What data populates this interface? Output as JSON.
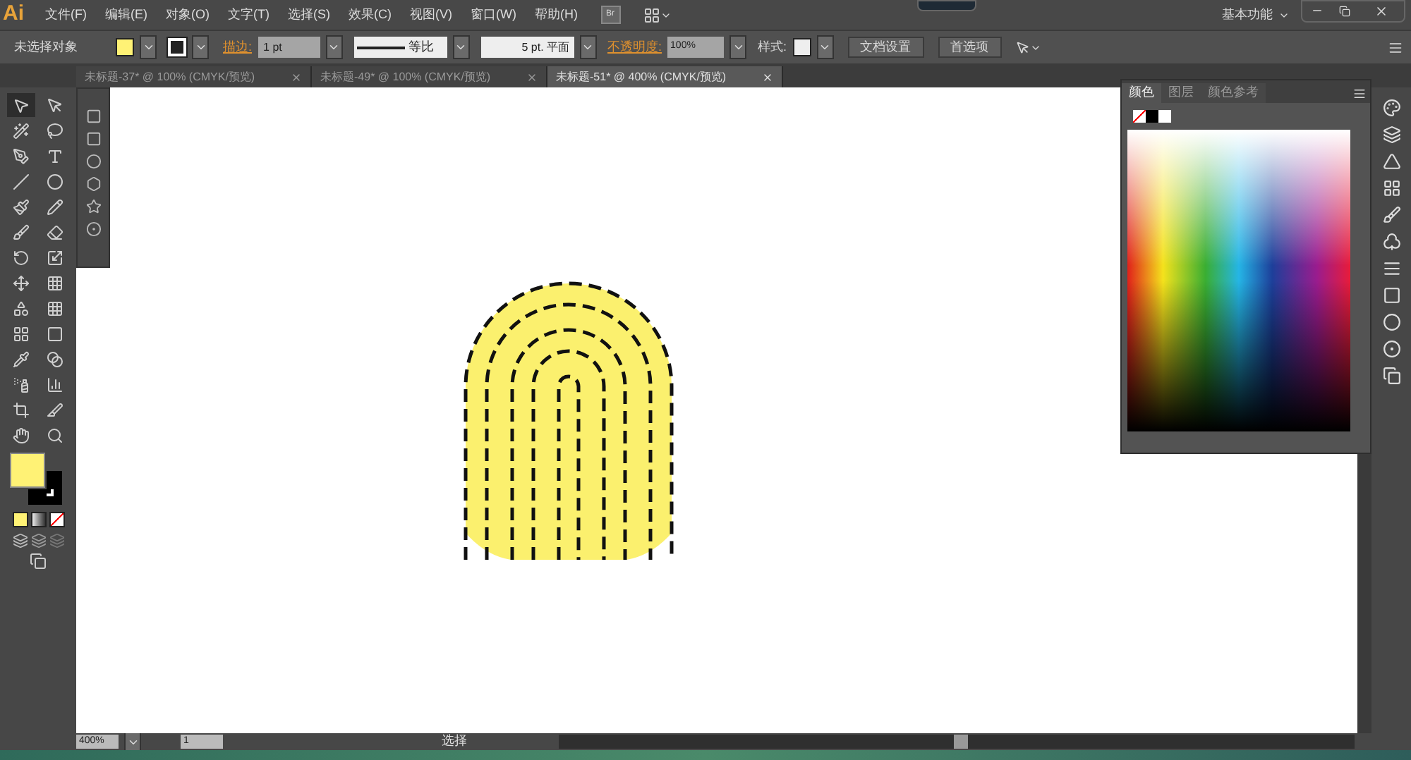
{
  "app": {
    "logo": "Ai",
    "menu": [
      "文件(F)",
      "编辑(E)",
      "对象(O)",
      "文字(T)",
      "选择(S)",
      "效果(C)",
      "视图(V)",
      "窗口(W)",
      "帮助(H)"
    ],
    "bridge": "Br",
    "workspace": "基本功能"
  },
  "control_bar": {
    "selection": "未选择对象",
    "stroke_label": "描边:",
    "stroke_weight": "1 pt",
    "profile": "等比",
    "brush": "5 pt. 平面",
    "opacity_label": "不透明度:",
    "opacity": "100%",
    "style_label": "样式:",
    "buttons": [
      "文档设置",
      "首选项"
    ]
  },
  "tabs": [
    {
      "label": "未标题-37* @ 100% (CMYK/预览)",
      "selected": false
    },
    {
      "label": "未标题-49* @ 100% (CMYK/预览)",
      "selected": false
    },
    {
      "label": "未标题-51* @ 400% (CMYK/预览)",
      "selected": true
    }
  ],
  "color_panel": {
    "tabs": [
      {
        "label": "颜色",
        "selected": true
      },
      {
        "label": "图层",
        "selected": false
      },
      {
        "label": "颜色参考",
        "selected": false
      }
    ]
  },
  "status_bar": {
    "zoom": "400%",
    "artboard": "1",
    "tool": "选择"
  }
}
